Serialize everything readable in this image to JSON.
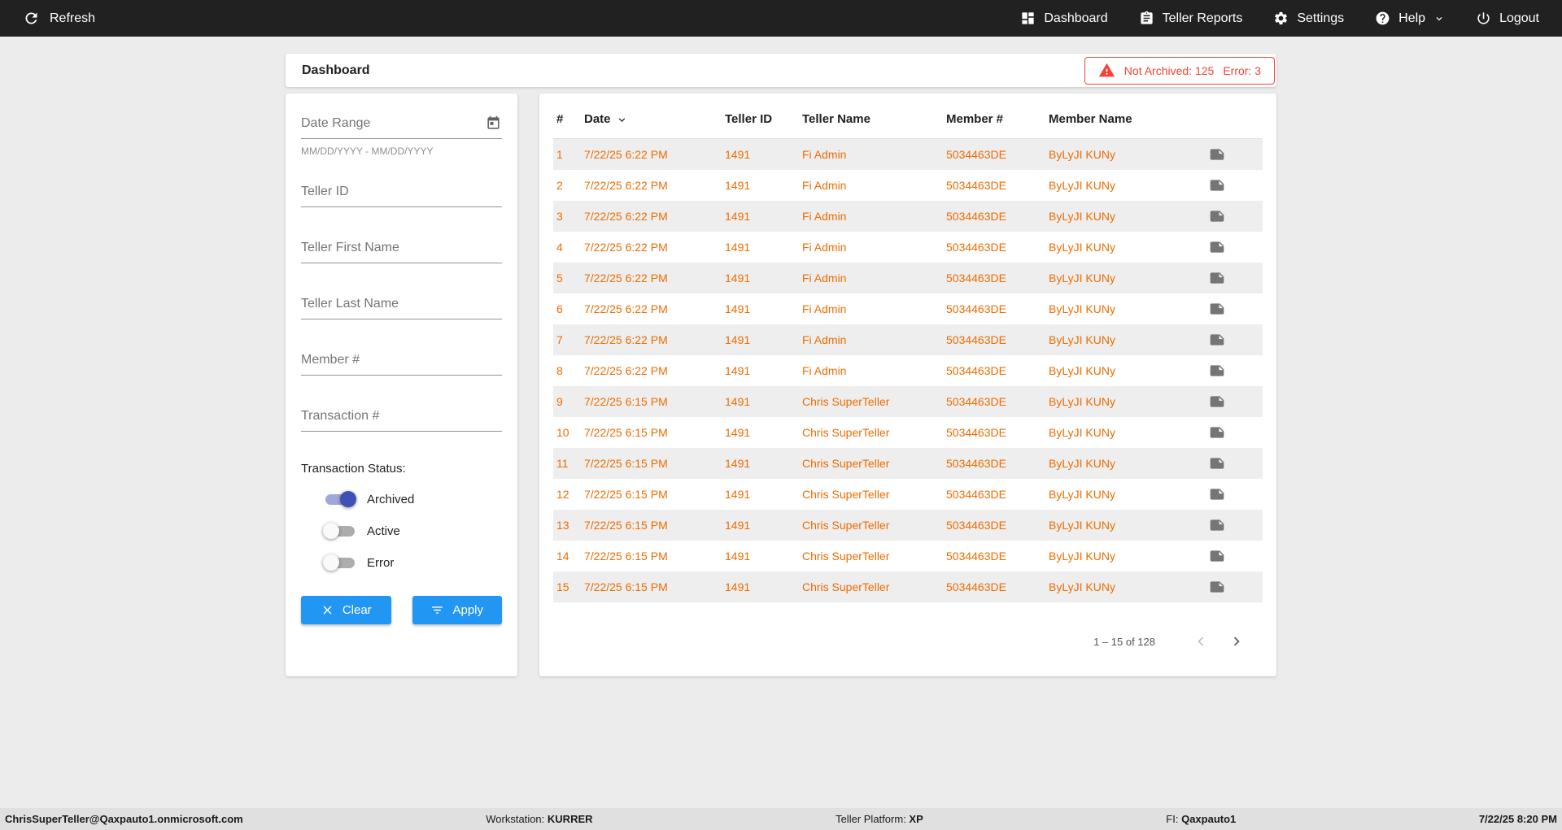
{
  "colors": {
    "accent_blue": "#2196f3",
    "row_text_orange": "#ef6c00",
    "alert_red": "#f44336",
    "toggle_on_blue": "#3f51b5",
    "topbar_dark": "#212121"
  },
  "topbar": {
    "refresh_label": "Refresh",
    "nav": [
      {
        "label": "Dashboard",
        "icon": "dashboard-icon"
      },
      {
        "label": "Teller Reports",
        "icon": "reports-icon"
      },
      {
        "label": "Settings",
        "icon": "gear-icon"
      },
      {
        "label": "Help",
        "icon": "help-icon"
      },
      {
        "label": "Logout",
        "icon": "power-icon"
      }
    ]
  },
  "header": {
    "title": "Dashboard",
    "alert": {
      "not_archived": "Not Archived: 125",
      "error": "Error: 3"
    }
  },
  "filters": {
    "date_range": {
      "placeholder": "Date Range",
      "hint": "MM/DD/YYYY - MM/DD/YYYY"
    },
    "fields": [
      {
        "placeholder": "Teller ID",
        "name": "teller-id-input"
      },
      {
        "placeholder": "Teller First Name",
        "name": "teller-first-name-input"
      },
      {
        "placeholder": "Teller Last Name",
        "name": "teller-last-name-input"
      },
      {
        "placeholder": "Member #",
        "name": "member-number-input"
      },
      {
        "placeholder": "Transaction #",
        "name": "transaction-number-input"
      }
    ],
    "status_label": "Transaction Status:",
    "toggles": [
      {
        "label": "Archived",
        "on": true
      },
      {
        "label": "Active",
        "on": false
      },
      {
        "label": "Error",
        "on": false
      }
    ],
    "clear_label": "Clear",
    "apply_label": "Apply"
  },
  "table": {
    "columns": [
      "#",
      "Date",
      "Teller ID",
      "Teller Name",
      "Member #",
      "Member Name"
    ],
    "rows": [
      {
        "num": "1",
        "date": "7/22/25 6:22 PM",
        "teller_id": "1491",
        "teller_name": "Fi Admin",
        "member_number": "5034463DE",
        "member_name": "ByLyJI KUNy"
      },
      {
        "num": "2",
        "date": "7/22/25 6:22 PM",
        "teller_id": "1491",
        "teller_name": "Fi Admin",
        "member_number": "5034463DE",
        "member_name": "ByLyJI KUNy"
      },
      {
        "num": "3",
        "date": "7/22/25 6:22 PM",
        "teller_id": "1491",
        "teller_name": "Fi Admin",
        "member_number": "5034463DE",
        "member_name": "ByLyJI KUNy"
      },
      {
        "num": "4",
        "date": "7/22/25 6:22 PM",
        "teller_id": "1491",
        "teller_name": "Fi Admin",
        "member_number": "5034463DE",
        "member_name": "ByLyJI KUNy"
      },
      {
        "num": "5",
        "date": "7/22/25 6:22 PM",
        "teller_id": "1491",
        "teller_name": "Fi Admin",
        "member_number": "5034463DE",
        "member_name": "ByLyJI KUNy"
      },
      {
        "num": "6",
        "date": "7/22/25 6:22 PM",
        "teller_id": "1491",
        "teller_name": "Fi Admin",
        "member_number": "5034463DE",
        "member_name": "ByLyJI KUNy"
      },
      {
        "num": "7",
        "date": "7/22/25 6:22 PM",
        "teller_id": "1491",
        "teller_name": "Fi Admin",
        "member_number": "5034463DE",
        "member_name": "ByLyJI KUNy"
      },
      {
        "num": "8",
        "date": "7/22/25 6:22 PM",
        "teller_id": "1491",
        "teller_name": "Fi Admin",
        "member_number": "5034463DE",
        "member_name": "ByLyJI KUNy"
      },
      {
        "num": "9",
        "date": "7/22/25 6:15 PM",
        "teller_id": "1491",
        "teller_name": "Chris SuperTeller",
        "member_number": "5034463DE",
        "member_name": "ByLyJI KUNy"
      },
      {
        "num": "10",
        "date": "7/22/25 6:15 PM",
        "teller_id": "1491",
        "teller_name": "Chris SuperTeller",
        "member_number": "5034463DE",
        "member_name": "ByLyJI KUNy"
      },
      {
        "num": "11",
        "date": "7/22/25 6:15 PM",
        "teller_id": "1491",
        "teller_name": "Chris SuperTeller",
        "member_number": "5034463DE",
        "member_name": "ByLyJI KUNy"
      },
      {
        "num": "12",
        "date": "7/22/25 6:15 PM",
        "teller_id": "1491",
        "teller_name": "Chris SuperTeller",
        "member_number": "5034463DE",
        "member_name": "ByLyJI KUNy"
      },
      {
        "num": "13",
        "date": "7/22/25 6:15 PM",
        "teller_id": "1491",
        "teller_name": "Chris SuperTeller",
        "member_number": "5034463DE",
        "member_name": "ByLyJI KUNy"
      },
      {
        "num": "14",
        "date": "7/22/25 6:15 PM",
        "teller_id": "1491",
        "teller_name": "Chris SuperTeller",
        "member_number": "5034463DE",
        "member_name": "ByLyJI KUNy"
      },
      {
        "num": "15",
        "date": "7/22/25 6:15 PM",
        "teller_id": "1491",
        "teller_name": "Chris SuperTeller",
        "member_number": "5034463DE",
        "member_name": "ByLyJI KUNy"
      }
    ],
    "pagination": {
      "range_label": "1 – 15 of 128"
    }
  },
  "footer": {
    "user": "ChrisSuperTeller@Qaxpauto1.onmicrosoft.com",
    "workstation_label": "Workstation:",
    "workstation": "KURRER",
    "platform_label": "Teller Platform:",
    "platform": "XP",
    "fi_label": "FI:",
    "fi": "Qaxpauto1",
    "datetime": "7/22/25 8:20 PM"
  }
}
